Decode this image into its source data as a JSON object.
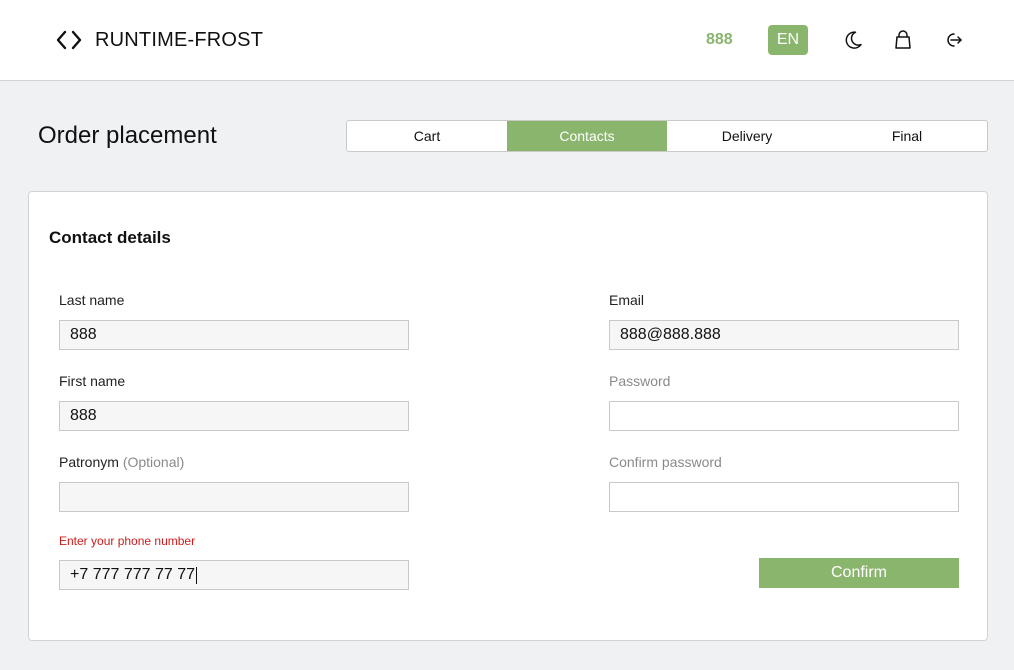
{
  "header": {
    "app_name": "RUNTIME-FROST",
    "balance": "888",
    "language": "EN",
    "icons": [
      "code-icon",
      "moon-icon",
      "bag-icon",
      "logout-icon"
    ]
  },
  "page": {
    "title": "Order placement"
  },
  "steps": [
    {
      "label": "Cart",
      "active": false
    },
    {
      "label": "Contacts",
      "active": true
    },
    {
      "label": "Delivery",
      "active": false
    },
    {
      "label": "Final",
      "active": false
    }
  ],
  "form": {
    "title": "Contact details",
    "last_name": {
      "label": "Last name",
      "value": "888"
    },
    "first_name": {
      "label": "First name",
      "value": "888"
    },
    "patronym": {
      "label": "Patronym",
      "optional": "(Optional)",
      "value": ""
    },
    "phone": {
      "error": "Enter your phone number",
      "value": "+7 777 777 77 77"
    },
    "email": {
      "label": "Email",
      "value": "888@888.888"
    },
    "password": {
      "label": "Password",
      "value": ""
    },
    "confirm_password": {
      "label": "Confirm password",
      "value": ""
    },
    "confirm_label": "Confirm"
  },
  "colors": {
    "accent": "#8ab56c",
    "error": "#d11a1a",
    "background": "#f0f1f3"
  }
}
